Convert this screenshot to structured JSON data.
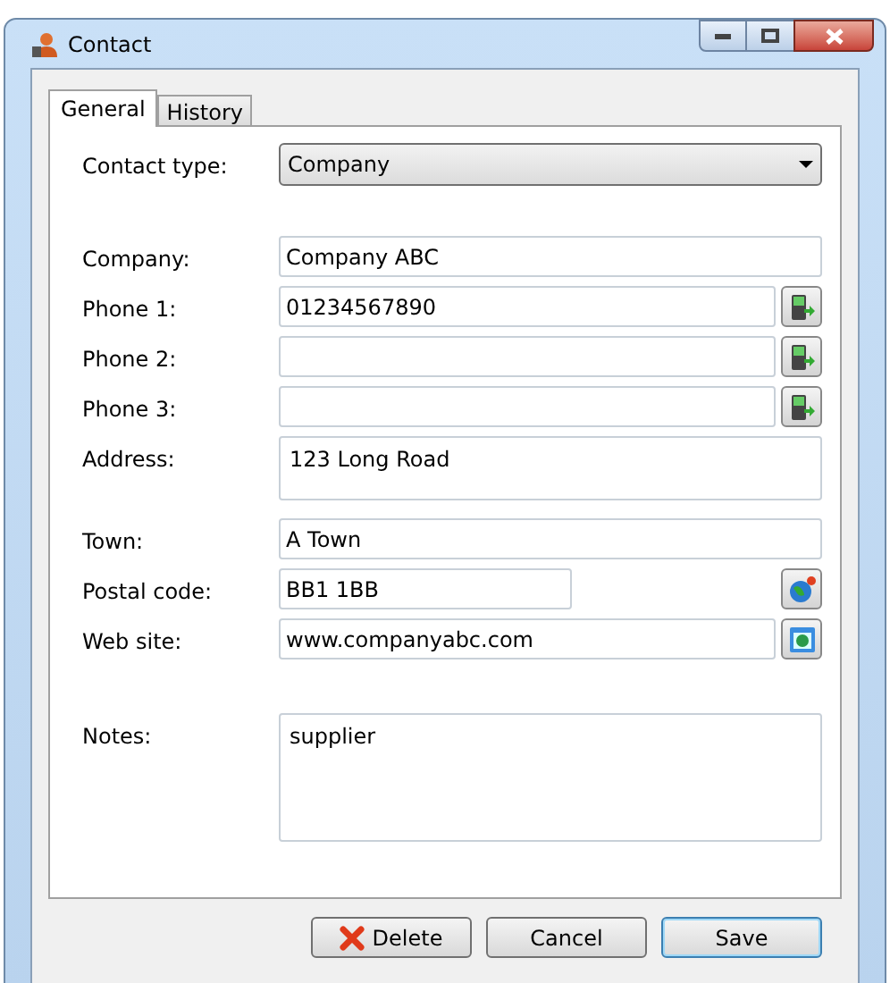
{
  "window": {
    "title": "Contact"
  },
  "tabs": [
    {
      "label": "General",
      "selected": true
    },
    {
      "label": "History",
      "selected": false
    }
  ],
  "sections": [
    [
      {
        "kind": "select",
        "label": "Contact type:",
        "value": "Company"
      }
    ],
    [
      {
        "kind": "text",
        "label": "Company:",
        "value": "Company ABC"
      },
      {
        "kind": "text",
        "label": "Phone 1:",
        "value": "01234567890",
        "action": {
          "kind": "phone"
        }
      },
      {
        "kind": "text",
        "label": "Phone 2:",
        "action": {
          "kind": "phone"
        }
      },
      {
        "kind": "text",
        "label": "Phone 3:",
        "action": {
          "kind": "phone"
        }
      },
      {
        "kind": "textarea",
        "label": "Address:",
        "value": "123 Long Road"
      },
      {
        "kind": "text",
        "label": "Town:",
        "value": "A Town"
      },
      {
        "kind": "short",
        "label": "Postal code:",
        "value": "BB1 1BB",
        "action": {
          "kind": "globe"
        }
      },
      {
        "kind": "text",
        "label": "Web site:",
        "value": "www.companyabc.com",
        "action": {
          "kind": "browser"
        }
      }
    ],
    [
      {
        "kind": "notes",
        "label": "Notes:",
        "value": "supplier"
      }
    ]
  ],
  "buttons": [
    {
      "label": "Delete",
      "kind": "delete",
      "default": false
    },
    {
      "label": "Cancel",
      "kind": "plain",
      "default": false
    },
    {
      "label": "Save",
      "kind": "plain",
      "default": true
    }
  ]
}
